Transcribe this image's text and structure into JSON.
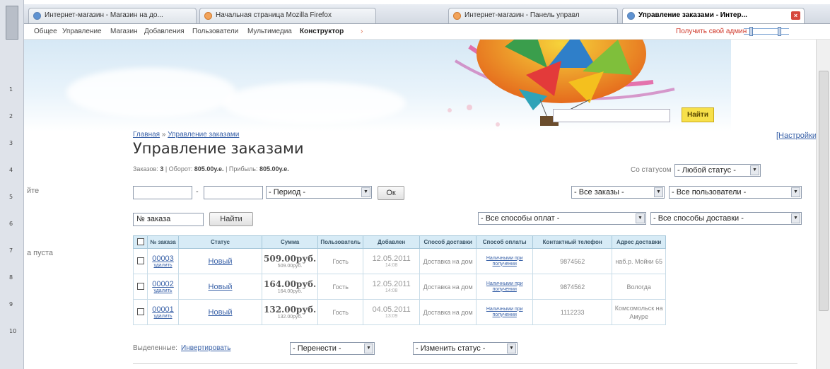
{
  "browser": {
    "tabs": [
      {
        "label": "Интернет-магазин - Магазин на до...",
        "icon": "globe-icon",
        "active": false
      },
      {
        "label": "Начальная страница Mozilla Firefox",
        "icon": "firefox-icon",
        "active": false
      },
      {
        "label": "Интернет-магазин - Панель управл",
        "icon": "globe-icon",
        "active": false
      },
      {
        "label": "Управление заказами - Интер...",
        "icon": "globe-icon",
        "active": true
      }
    ]
  },
  "admin_menu": {
    "items": [
      "Общее",
      "Управление",
      "Магазин",
      "Добавления",
      "Пользователи",
      "Мультимедиа",
      "Конструктор"
    ],
    "get_admin_link": "Получить свой админ"
  },
  "header": {
    "search_button": "Найти"
  },
  "sidebar": {
    "fragment1": "йте",
    "fragment2": "а пуста"
  },
  "breadcrumb": {
    "home": "Главная",
    "separator": "»",
    "current": "Управление заказами"
  },
  "settings_link": "[Настройки]",
  "page_title": "Управление заказами",
  "stats": {
    "orders_label": "Заказов:",
    "orders_value": "3",
    "turnover_label": "| Оборот:",
    "turnover_value": "805.00у.е.",
    "profit_label": "| Прибыль:",
    "profit_value": "805.00у.е."
  },
  "filters": {
    "status_label": "Со статусом",
    "status_select": "- Любой статус -",
    "period_select": "- Период -",
    "ok_button": "Ок",
    "orders_select": "- Все заказы -",
    "users_select": "- Все пользователи -",
    "order_number_placeholder": "№ заказа",
    "find_button": "Найти",
    "payment_select": "- Все способы оплат -",
    "delivery_select": "- Все способы доставки -"
  },
  "table": {
    "headers": [
      "№ заказа",
      "Статус",
      "Сумма",
      "Пользователь",
      "Добавлен",
      "Способ доставки",
      "Способ оплаты",
      "Контактный телефон",
      "Адрес доставки"
    ],
    "rows": [
      {
        "number": "00003",
        "delete": "удалить",
        "status": "Новый",
        "sum": "509.00руб.",
        "sum_sub": "509.00руб.",
        "user": "Гость",
        "date": "12.05.2011",
        "time": "14:08",
        "delivery": "Доставка на дом",
        "payment": "Наличными при получении",
        "phone": "9874562",
        "address": "наб.р. Мойки 65"
      },
      {
        "number": "00002",
        "delete": "удалить",
        "status": "Новый",
        "sum": "164.00руб.",
        "sum_sub": "164.00руб.",
        "user": "Гость",
        "date": "12.05.2011",
        "time": "14:08",
        "delivery": "Доставка на дом",
        "payment": "Наличными при получении",
        "phone": "9874562",
        "address": "Вологда"
      },
      {
        "number": "00001",
        "delete": "удалить",
        "status": "Новый",
        "sum": "132.00руб.",
        "sum_sub": "132.00руб.",
        "user": "Гость",
        "date": "04.05.2011",
        "time": "13:09",
        "delivery": "Доставка на дом",
        "payment": "Наличными при получении",
        "phone": "1112233",
        "address": "Комсомольск на Амуре"
      }
    ]
  },
  "bulk": {
    "selected_label": "Выделенные:",
    "invert_link": "Инвертировать",
    "move_select": "- Перенести -",
    "change_status_select": "- Изменить статус -"
  },
  "ruler": {
    "numbers": [
      "1",
      "2",
      "3",
      "4",
      "5",
      "6",
      "7",
      "8",
      "9",
      "10"
    ]
  }
}
